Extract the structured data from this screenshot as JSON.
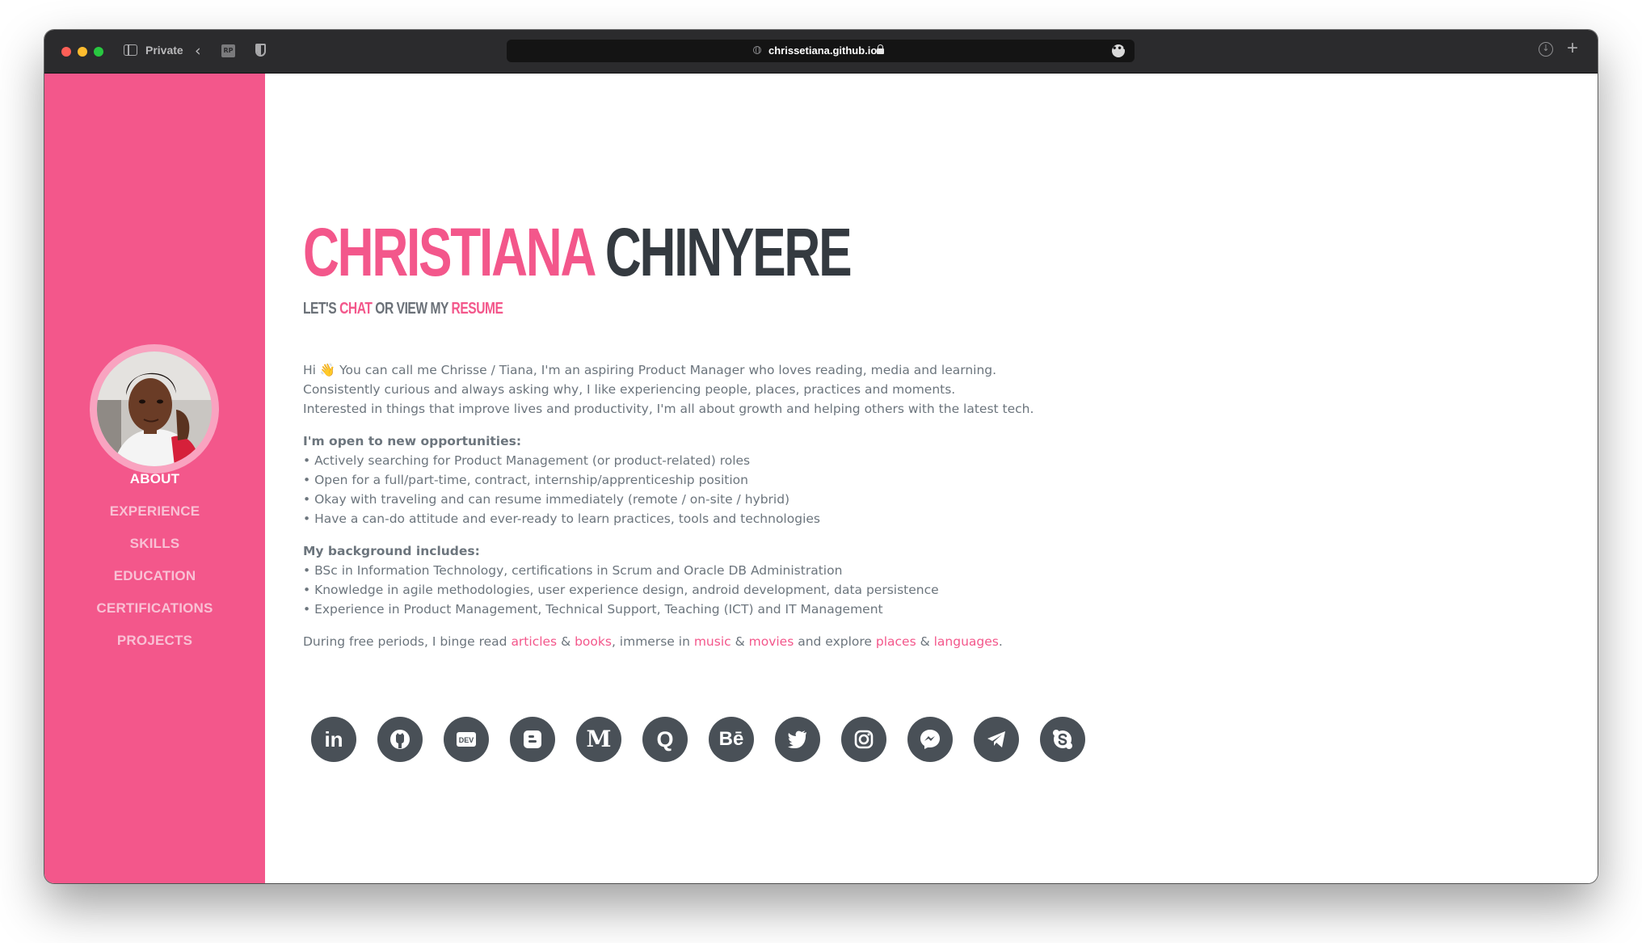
{
  "browser": {
    "private_label": "Private",
    "ext_label": "RP",
    "url": "chrissetiana.github.io"
  },
  "profile": {
    "first_name": "CHRISTIANA",
    "last_name": "CHINYERE",
    "tagline": {
      "prefix": "LET'S",
      "chat": "CHAT",
      "middle": "OR VIEW MY",
      "resume": "RESUME"
    }
  },
  "nav": {
    "items": [
      {
        "label": "About",
        "active": true
      },
      {
        "label": "Experience"
      },
      {
        "label": "Skills"
      },
      {
        "label": "Education"
      },
      {
        "label": "Certifications"
      },
      {
        "label": "Projects"
      }
    ]
  },
  "about": {
    "intro": [
      "Hi 👋 You can call me Chrisse / Tiana, I'm an aspiring Product Manager who loves reading, media and learning.",
      "Consistently curious and always asking why, I like experiencing people, places, practices and moments.",
      "Interested in things that improve lives and productivity, I'm all about growth and helping others with the latest tech."
    ],
    "opportunities_heading": "I'm open to new opportunities:",
    "opportunities": [
      "• Actively searching for Product Management (or product-related) roles",
      "• Open for a full/part-time, contract, internship/apprenticeship position",
      "• Okay with traveling and can resume immediately (remote / on-site / hybrid)",
      "• Have a can-do attitude and ever-ready to learn practices, tools and technologies"
    ],
    "background_heading": "My background includes:",
    "background": [
      "• BSc in Information Technology, certifications in Scrum and Oracle DB Administration",
      "• Knowledge in agile methodologies, user experience design, android development, data persistence",
      "• Experience in Product Management, Technical Support, Teaching (ICT) and IT Management"
    ],
    "free_time": {
      "t1": "During free periods, I binge read ",
      "articles": "articles",
      "amp1": " & ",
      "books": "books",
      "t2": ", immerse in ",
      "music": "music",
      "amp2": " & ",
      "movies": "movies",
      "t3": " and explore ",
      "places": "places",
      "amp3": " & ",
      "languages": "languages",
      "t4": "."
    }
  },
  "social": {
    "linkedin": "in",
    "dev": "DEV",
    "medium": "M",
    "quora": "Q",
    "behance": "Bē"
  },
  "colors": {
    "accent": "#f3578b",
    "dark": "#343a40",
    "text": "#6c757d",
    "social_bg": "#495057"
  }
}
